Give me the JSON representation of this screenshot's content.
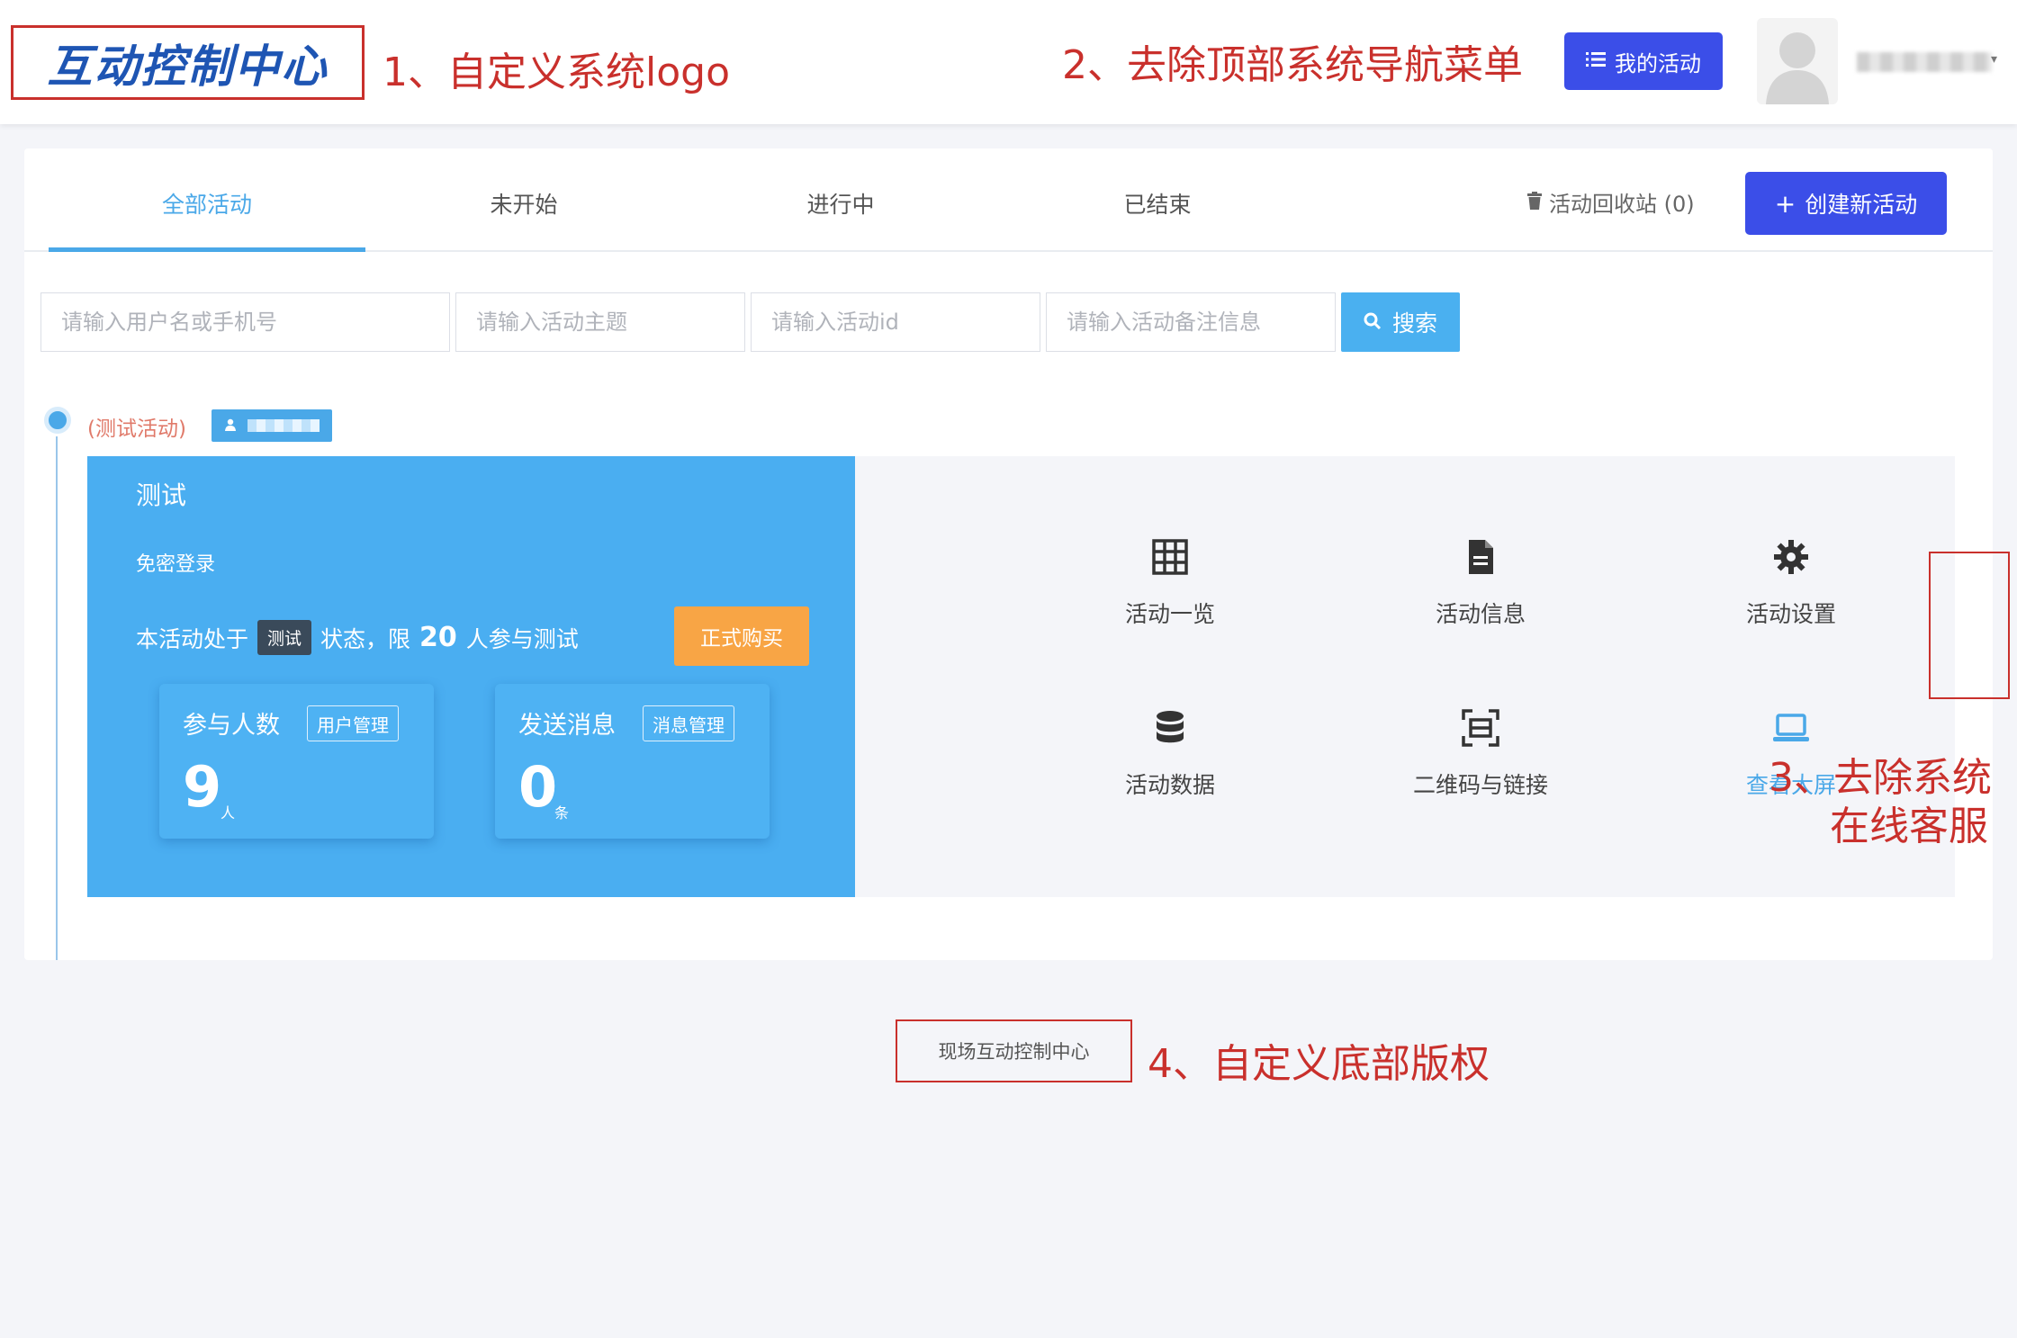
{
  "header": {
    "logo_text": "互动控制中心",
    "my_activity_label": "我的活动",
    "annotation_logo": "1、自定义系统logo",
    "annotation_nav": "2、去除顶部系统导航菜单"
  },
  "tabs": [
    {
      "label": "全部活动",
      "active": true
    },
    {
      "label": "未开始",
      "active": false
    },
    {
      "label": "进行中",
      "active": false
    },
    {
      "label": "已结束",
      "active": false
    }
  ],
  "toolbar": {
    "recycle_label": "活动回收站 (0)",
    "create_label": "创建新活动"
  },
  "search": {
    "user_placeholder": "请输入用户名或手机号",
    "theme_placeholder": "请输入活动主题",
    "id_placeholder": "请输入活动id",
    "note_placeholder": "请输入活动备注信息",
    "button_label": "搜索"
  },
  "activity": {
    "tag": "(测试活动)",
    "title": "测试",
    "login_mode": "免密登录",
    "status_prefix": "本活动处于",
    "status_chip": "测试",
    "status_mid": "状态，限",
    "limit": "20",
    "status_suffix": "人参与测试",
    "buy_label": "正式购买",
    "participants": {
      "label": "参与人数",
      "button": "用户管理",
      "value": "9",
      "unit": "人"
    },
    "messages": {
      "label": "发送消息",
      "button": "消息管理",
      "value": "0",
      "unit": "条"
    }
  },
  "menu": {
    "overview": "活动一览",
    "info": "活动信息",
    "settings": "活动设置",
    "data": "活动数据",
    "qrcode": "二维码与链接",
    "screen": "查看大屏"
  },
  "annotations": {
    "service_line1": "3、去除系统",
    "service_line2": "在线客服",
    "footer": "4、自定义底部版权"
  },
  "footer": {
    "copyright": "现场互动控制中心"
  },
  "colors": {
    "primary": "#3b4ee8",
    "accent_blue": "#4aa8e8",
    "panel_blue": "#4aaef1",
    "buy_orange": "#f8a545",
    "annotation_red": "#c9302c"
  }
}
